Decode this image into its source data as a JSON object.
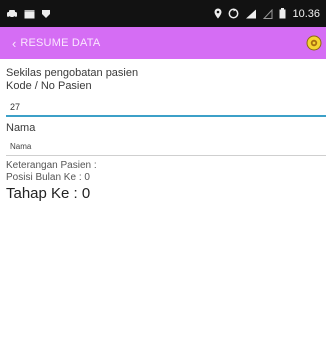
{
  "status_bar": {
    "time": "10.36",
    "left_icons": [
      "car-icon",
      "calendar-icon",
      "shield-icon"
    ],
    "right_icons": [
      "location-pin-icon",
      "sync-icon",
      "signal-icon",
      "signal-empty-icon",
      "battery-icon"
    ]
  },
  "app_bar": {
    "title": "RESUME DATA",
    "back_icon": "back-chevron-icon",
    "action_icon": "settings-badge-icon",
    "color": "#d56df4"
  },
  "form": {
    "subtitle": "Sekilas pengobatan pasien",
    "code_label": "Kode / No Pasien",
    "code_value": "27",
    "name_label": "Nama",
    "name_placeholder": "Nama"
  },
  "info": {
    "notes_label": "Keterangan Pasien :",
    "month_position": "Posisi Bulan Ke : 0",
    "stage": "Tahap  Ke : 0"
  },
  "colors": {
    "status_bar": "#121212",
    "input_focus": "#3ca0c8"
  }
}
